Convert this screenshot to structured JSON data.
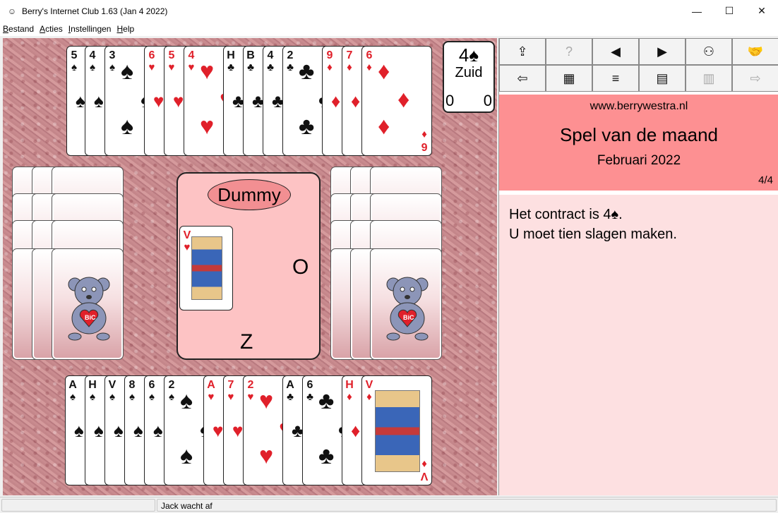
{
  "window": {
    "title": "Berry's Internet Club 1.63 (Jan  4 2022)",
    "minimize": "—",
    "maximize": "☐",
    "close": "✕"
  },
  "menu": [
    {
      "u": "B",
      "rest": "estand"
    },
    {
      "u": "A",
      "rest": "cties"
    },
    {
      "u": "I",
      "rest": "nstellingen"
    },
    {
      "u": "H",
      "rest": "elp"
    }
  ],
  "north_hand": [
    {
      "rank": "5",
      "suit": "♠",
      "color": "blk"
    },
    {
      "rank": "4",
      "suit": "♠",
      "color": "blk"
    },
    {
      "rank": "3",
      "suit": "♠",
      "color": "blk"
    },
    {
      "rank": "6",
      "suit": "♥",
      "color": "red"
    },
    {
      "rank": "5",
      "suit": "♥",
      "color": "red"
    },
    {
      "rank": "4",
      "suit": "♥",
      "color": "red"
    },
    {
      "rank": "H",
      "suit": "♣",
      "color": "blk"
    },
    {
      "rank": "B",
      "suit": "♣",
      "color": "blk"
    },
    {
      "rank": "4",
      "suit": "♣",
      "color": "blk"
    },
    {
      "rank": "2",
      "suit": "♣",
      "color": "blk"
    },
    {
      "rank": "9",
      "suit": "♦",
      "color": "red"
    },
    {
      "rank": "7",
      "suit": "♦",
      "color": "red"
    },
    {
      "rank": "6",
      "suit": "♦",
      "color": "red"
    }
  ],
  "south_hand": [
    {
      "rank": "A",
      "suit": "♠",
      "color": "blk"
    },
    {
      "rank": "H",
      "suit": "♠",
      "color": "blk"
    },
    {
      "rank": "V",
      "suit": "♠",
      "color": "blk"
    },
    {
      "rank": "8",
      "suit": "♠",
      "color": "blk"
    },
    {
      "rank": "6",
      "suit": "♠",
      "color": "blk"
    },
    {
      "rank": "2",
      "suit": "♠",
      "color": "blk"
    },
    {
      "rank": "A",
      "suit": "♥",
      "color": "red"
    },
    {
      "rank": "7",
      "suit": "♥",
      "color": "red"
    },
    {
      "rank": "2",
      "suit": "♥",
      "color": "red"
    },
    {
      "rank": "A",
      "suit": "♣",
      "color": "blk"
    },
    {
      "rank": "6",
      "suit": "♣",
      "color": "blk"
    },
    {
      "rank": "H",
      "suit": "♦",
      "color": "red"
    },
    {
      "rank": "V",
      "suit": "♦",
      "color": "red"
    }
  ],
  "center": {
    "dummy_label": "Dummy",
    "east_seat": "O",
    "south_seat": "Z",
    "played_card": {
      "rank": "V",
      "suit": "♥",
      "color": "red"
    }
  },
  "contract": {
    "bid": "4♠",
    "declarer": "Zuid",
    "score_left": "0",
    "score_right": "0"
  },
  "back_logo": "BiC",
  "toolbar": [
    {
      "icon": "share-icon",
      "glyph": "⇪",
      "enabled": true
    },
    {
      "icon": "help-icon",
      "glyph": "?",
      "enabled": false
    },
    {
      "icon": "prev-icon",
      "glyph": "◀",
      "enabled": true
    },
    {
      "icon": "next-icon",
      "glyph": "▶",
      "enabled": true
    },
    {
      "icon": "players-icon",
      "glyph": "⚇",
      "enabled": true
    },
    {
      "icon": "handshake-icon",
      "glyph": "🤝",
      "enabled": false
    },
    {
      "icon": "back-arrow-icon",
      "glyph": "⇦",
      "enabled": true
    },
    {
      "icon": "scoresheet-icon",
      "glyph": "▦",
      "enabled": true
    },
    {
      "icon": "bidding-box-icon",
      "glyph": "≡",
      "enabled": true
    },
    {
      "icon": "cards-icon",
      "glyph": "▤",
      "enabled": true
    },
    {
      "icon": "columns-icon",
      "glyph": "▥",
      "enabled": false
    },
    {
      "icon": "forward-arrow-icon",
      "glyph": "⇨",
      "enabled": false
    }
  ],
  "info": {
    "site": "www.berrywestra.nl",
    "headline": "Spel van de maand",
    "month": "Februari 2022",
    "page": "4/4"
  },
  "message": {
    "line1": "Het contract is 4♠.",
    "line2": "U moet tien slagen maken."
  },
  "status": {
    "text": "Jack wacht af"
  },
  "colors": {
    "panel_header": "#fd9092",
    "message_bg": "#fde0e1",
    "center_bg": "#fdc3c4",
    "oval": "#f28f92"
  }
}
